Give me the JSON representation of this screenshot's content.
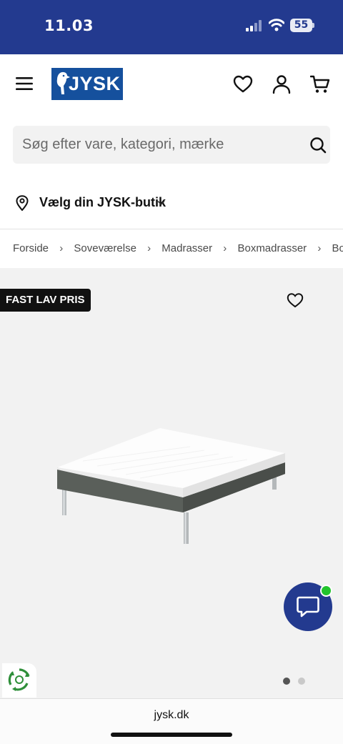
{
  "status_bar": {
    "time": "11.03",
    "battery": "55"
  },
  "header": {
    "logo_text": "JYSK"
  },
  "search": {
    "placeholder": "Søg efter vare, kategori, mærke"
  },
  "store": {
    "label": "Vælg din JYSK-butik"
  },
  "breadcrumb": [
    "Forside",
    "Soveværelse",
    "Madrasser",
    "Boxmadrasser",
    "Boxmadrasser"
  ],
  "product": {
    "badge": "FAST LAV PRIS",
    "image_count": 2,
    "active_image": 1
  },
  "browser": {
    "url": "jysk.dk"
  },
  "colors": {
    "brand_blue": "#233a8f",
    "logo_blue": "#15509d",
    "online_green": "#22c42d"
  },
  "icons": [
    "menu-icon",
    "heart-icon",
    "account-icon",
    "cart-icon",
    "search-icon",
    "location-pin-icon",
    "chevron-down-icon",
    "chevron-right-icon",
    "chat-icon",
    "recycle-icon"
  ]
}
